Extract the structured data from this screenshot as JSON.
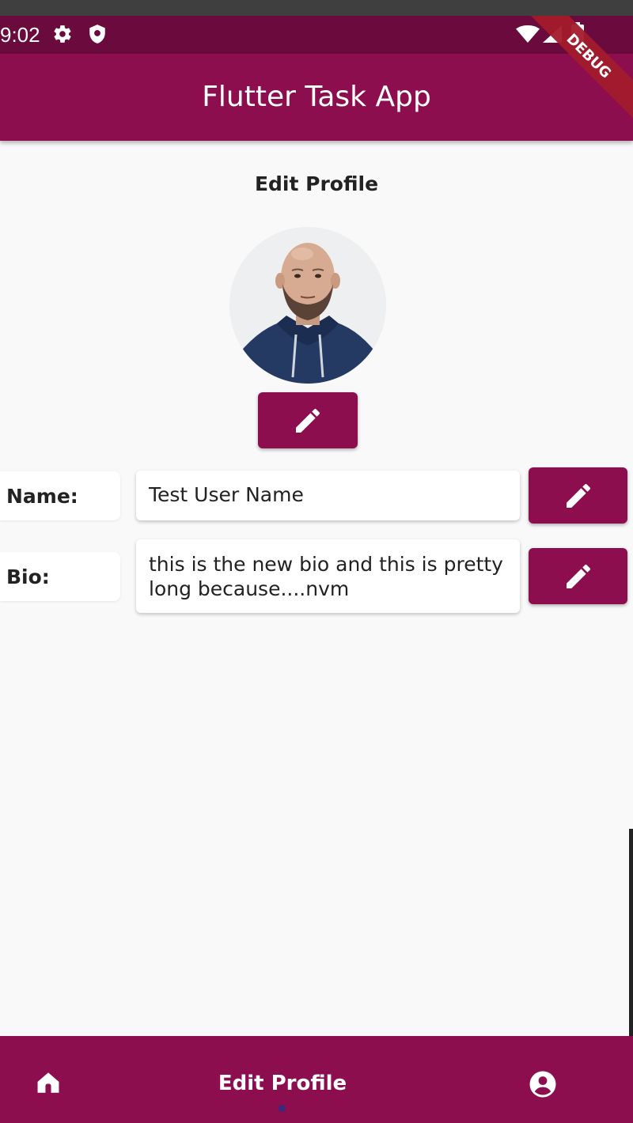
{
  "status_bar": {
    "time": "9:02",
    "icons": [
      "gear-icon",
      "shield-icon",
      "wifi-icon",
      "signal-icon",
      "battery-icon"
    ],
    "background": "#6b0a3c"
  },
  "app_bar": {
    "title": "Flutter Task App",
    "background": "#8c0e4f"
  },
  "debug_banner": {
    "label": "DEBUG",
    "color": "#a31b2b"
  },
  "page": {
    "title": "Edit Profile",
    "avatar_edit_icon": "pencil-icon"
  },
  "fields": {
    "name": {
      "label": "Name:",
      "value": "Test User Name"
    },
    "bio": {
      "label": "Bio:",
      "value": "this is the new bio and this is pretty long because....nvm"
    }
  },
  "bottom_nav": {
    "items": [
      {
        "icon": "home-icon"
      },
      {
        "label": "Edit Profile"
      },
      {
        "icon": "account-circle-icon"
      }
    ],
    "background": "#8c0e4f"
  },
  "colors": {
    "accent": "#8c0e4f",
    "page_background": "#f9f9fa",
    "text": "#222222"
  }
}
